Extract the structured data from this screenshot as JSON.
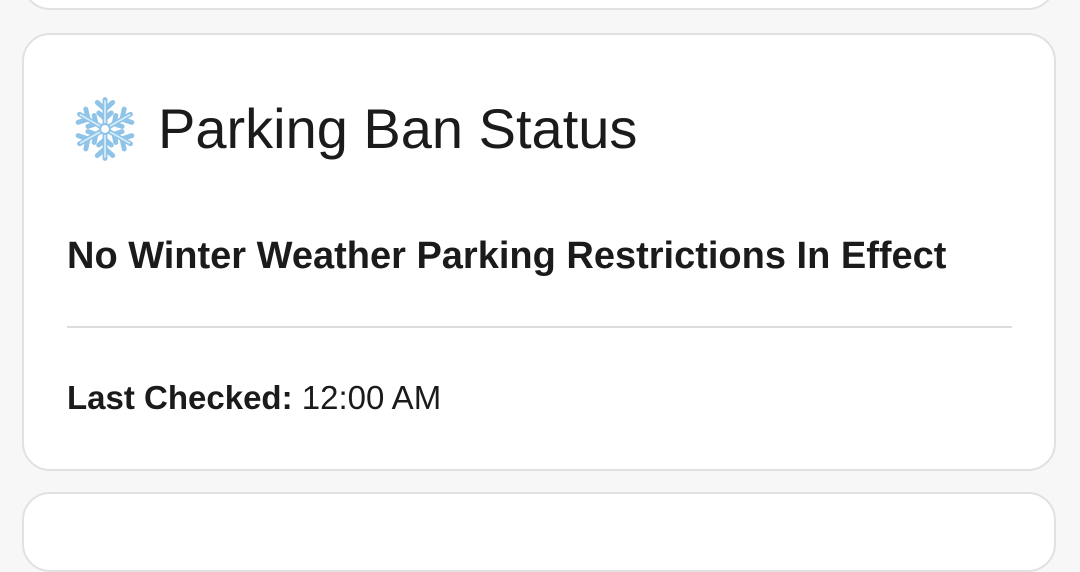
{
  "card": {
    "icon": "snowflake-icon",
    "title": "Parking Ban Status",
    "status_message": "No Winter Weather Parking Restrictions In Effect",
    "last_checked_label": "Last Checked:",
    "last_checked_value": "12:00 AM"
  },
  "colors": {
    "background": "#f7f7f7",
    "card_background": "#ffffff",
    "card_border": "#e1e1e1",
    "divider": "#dcdcdc",
    "text": "#1b1b1b",
    "icon": "#8fc3e8"
  }
}
